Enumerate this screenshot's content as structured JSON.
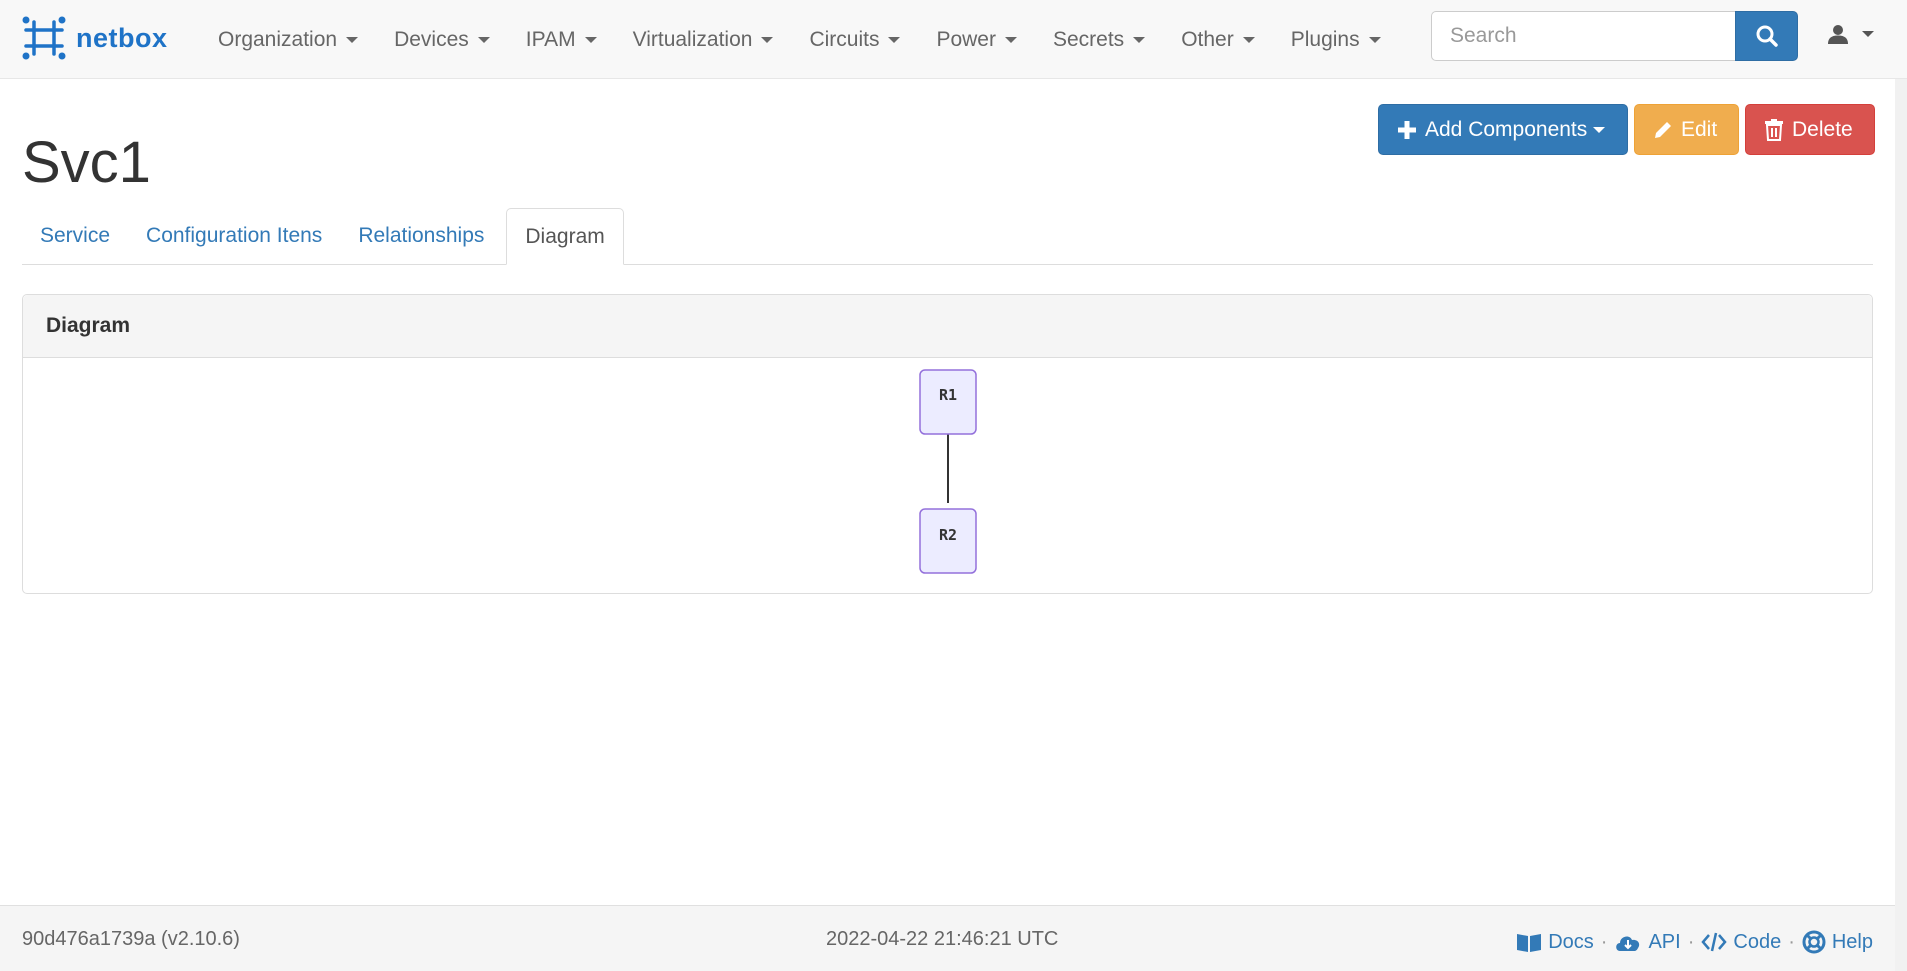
{
  "brand": {
    "name": "netbox",
    "color": "#1f73c7"
  },
  "nav": {
    "items": [
      {
        "label": "Organization"
      },
      {
        "label": "Devices"
      },
      {
        "label": "IPAM"
      },
      {
        "label": "Virtualization"
      },
      {
        "label": "Circuits"
      },
      {
        "label": "Power"
      },
      {
        "label": "Secrets"
      },
      {
        "label": "Other"
      },
      {
        "label": "Plugins"
      }
    ],
    "search": {
      "placeholder": "Search",
      "value": ""
    },
    "user_icon": "user-icon"
  },
  "page": {
    "title": "Svc1",
    "actions": {
      "add_components": "Add Components",
      "edit": "Edit",
      "delete": "Delete"
    },
    "tabs": [
      {
        "label": "Service",
        "active": false
      },
      {
        "label": "Configuration Itens",
        "active": false
      },
      {
        "label": "Relationships",
        "active": false
      },
      {
        "label": "Diagram",
        "active": true
      }
    ]
  },
  "panel": {
    "heading": "Diagram",
    "diagram": {
      "nodes": [
        {
          "label": "R1"
        },
        {
          "label": "R2"
        }
      ],
      "edges": [
        {
          "from": "R1",
          "to": "R2"
        }
      ]
    }
  },
  "footer": {
    "version": "90d476a1739a (v2.10.6)",
    "timestamp": "2022-04-22 21:46:21 UTC",
    "separator": "·",
    "links": {
      "docs": "Docs",
      "api": "API",
      "code": "Code",
      "help": "Help"
    }
  },
  "colors": {
    "primary": "#337ab7",
    "warning": "#f0ad4e",
    "danger": "#d9534f",
    "node_fill": "#ececff",
    "node_stroke": "#9370db"
  }
}
